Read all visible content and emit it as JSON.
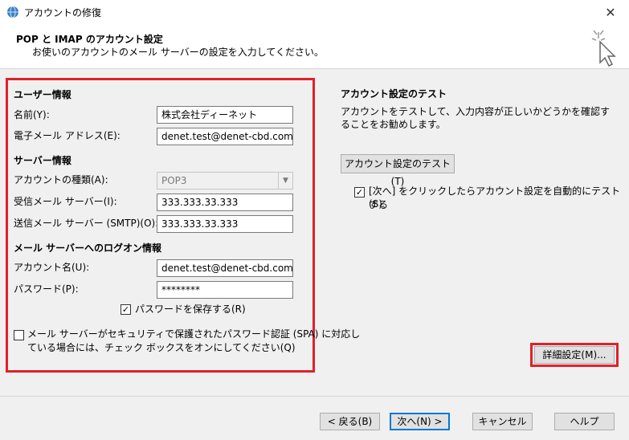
{
  "window": {
    "title": "アカウントの修復",
    "close_icon": "✕"
  },
  "header": {
    "title": "POP と IMAP のアカウント設定",
    "subtitle": "お使いのアカウントのメール サーバーの設定を入力してください。"
  },
  "user_info": {
    "section_title": "ユーザー情報",
    "name_label": "名前(Y):",
    "name_value": "株式会社ディーネット",
    "email_label": "電子メール アドレス(E):",
    "email_value": "denet.test@denet-cbd.com"
  },
  "server_info": {
    "section_title": "サーバー情報",
    "account_type_label": "アカウントの種類(A):",
    "account_type_value": "POP3",
    "incoming_label": "受信メール サーバー(I):",
    "incoming_value": "333.333.33.333",
    "outgoing_label": "送信メール サーバー (SMTP)(O):",
    "outgoing_value": "333.333.33.333"
  },
  "logon_info": {
    "section_title": "メール サーバーへのログオン情報",
    "account_name_label": "アカウント名(U):",
    "account_name_value": "denet.test@denet-cbd.com",
    "password_label": "パスワード(P):",
    "password_value": "********",
    "save_password_label": "パスワードを保存する(R)",
    "save_password_checked": true,
    "spa_label_line1": "メール サーバーがセキュリティで保護されたパスワード認証 (SPA) に対応し",
    "spa_label_line2": "ている場合には、チェック ボックスをオンにしてください(Q)",
    "spa_checked": false
  },
  "test": {
    "section_title": "アカウント設定のテスト",
    "description": "アカウントをテストして、入力内容が正しいかどうかを確認することをお勧めします。",
    "test_button_label": "アカウント設定のテスト(T)",
    "auto_test_label_line1": "[次へ] をクリックしたらアカウント設定を自動的にテストする",
    "auto_test_label_line2": "(S)",
    "auto_test_checked": true
  },
  "advanced": {
    "button_label": "詳細設定(M)..."
  },
  "footer": {
    "back_label": "< 戻る(B)",
    "next_label": "次へ(N) >",
    "cancel_label": "キャンセル",
    "help_label": "ヘルプ"
  },
  "colors": {
    "highlight": "#e0202a",
    "primary_border": "#0078d7"
  }
}
